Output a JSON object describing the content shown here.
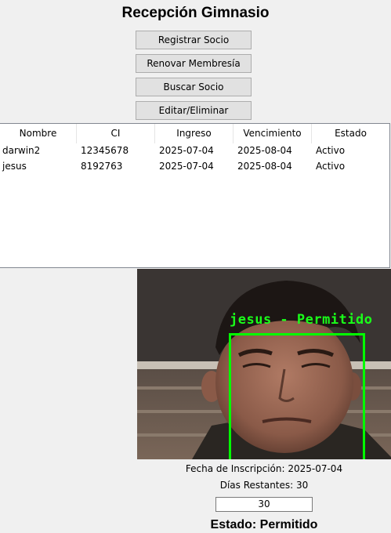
{
  "app": {
    "title": "Recepción Gimnasio"
  },
  "buttons": {
    "register": "Registrar Socio",
    "renew": "Renovar Membresía",
    "search": "Buscar Socio",
    "edit_delete": "Editar/Eliminar"
  },
  "table": {
    "columns": [
      "Nombre",
      "CI",
      "Ingreso",
      "Vencimiento",
      "Estado"
    ],
    "rows": [
      [
        "darwin2",
        "12345678",
        "2025-07-04",
        "2025-08-04",
        "Activo"
      ],
      [
        "jesus",
        "8192763",
        "2025-07-04",
        "2025-08-04",
        "Activo"
      ]
    ]
  },
  "camera": {
    "overlay_text": "jesus - Permitido",
    "box_color": "#00ff00"
  },
  "info": {
    "inscription": "Fecha de Inscripción: 2025-07-04",
    "days_remaining": "Días Restantes: 30",
    "days_input_value": "30",
    "status": "Estado: Permitido"
  }
}
